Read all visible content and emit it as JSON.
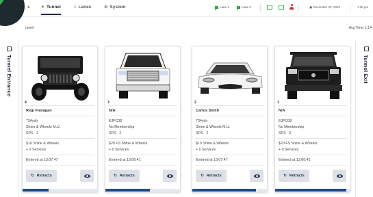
{
  "nav": {
    "partial_label": "s",
    "tabs": [
      {
        "icon": "tunnel-icon",
        "label": "Tunnel",
        "active": true
      },
      {
        "icon": "lanes-icon",
        "label": "Lanes",
        "active": false
      },
      {
        "icon": "gear-icon",
        "label": "System",
        "active": false
      }
    ],
    "lanes": [
      {
        "icon": "flag-icon",
        "label": "Lane 1"
      },
      {
        "icon": "flag-icon",
        "label": "Lane 2"
      }
    ],
    "date": "December 20, 2019",
    "time": "1:08 pm"
  },
  "subheader": {
    "title": "unnel",
    "avg_time": "Avg Time: 1:14"
  },
  "sides": {
    "entrance": "Tunnel Entrance",
    "exit": "Tunnel Exit"
  },
  "colors": {
    "accent": "#1f4a8a",
    "green": "#33b24a",
    "red": "#d02b2b"
  },
  "cards": [
    {
      "position": "4",
      "name": "Regi Flanagan",
      "lines": [
        "734ydn",
        "Shine & Wheels M.U.",
        "SPS - 2"
      ],
      "service": "$10 Shine & Wheels",
      "services_count": "+ 0 Services",
      "entered": "Entered at 13:07:47",
      "retract_label": "Retracts",
      "vehicle": "jeep",
      "progress": 0.35
    },
    {
      "position": "3",
      "name": "N/A",
      "lines": [
        "EJFC08",
        "No Membership",
        "SPS - 2"
      ],
      "service": "$20 FS Shine & Wheels",
      "services_count": "+ 0 Services",
      "entered": "Entered at 13:06:41",
      "retract_label": "Retracts",
      "vehicle": "truck",
      "progress": 0.6
    },
    {
      "position": "2",
      "name": "Carlos Smith",
      "lines": [
        "734ydn",
        "Shine & Wheels M.U.",
        "SPS - 2"
      ],
      "service": "$10 Shine & Wheels",
      "services_count": "+ 0 Services",
      "entered": "Entered at 13:07:47",
      "retract_label": "Retracts",
      "vehicle": "sedan",
      "progress": 0.85
    },
    {
      "position": "1",
      "name": "N/A",
      "lines": [
        "EJFC08",
        "No Membership",
        "SPS - 2"
      ],
      "service": "$20 FS Shine & Wheels",
      "services_count": "+ 0 Services",
      "entered": "Entered at 13:06:41",
      "retract_label": "Retracts",
      "vehicle": "suv",
      "progress": 0.95
    }
  ]
}
